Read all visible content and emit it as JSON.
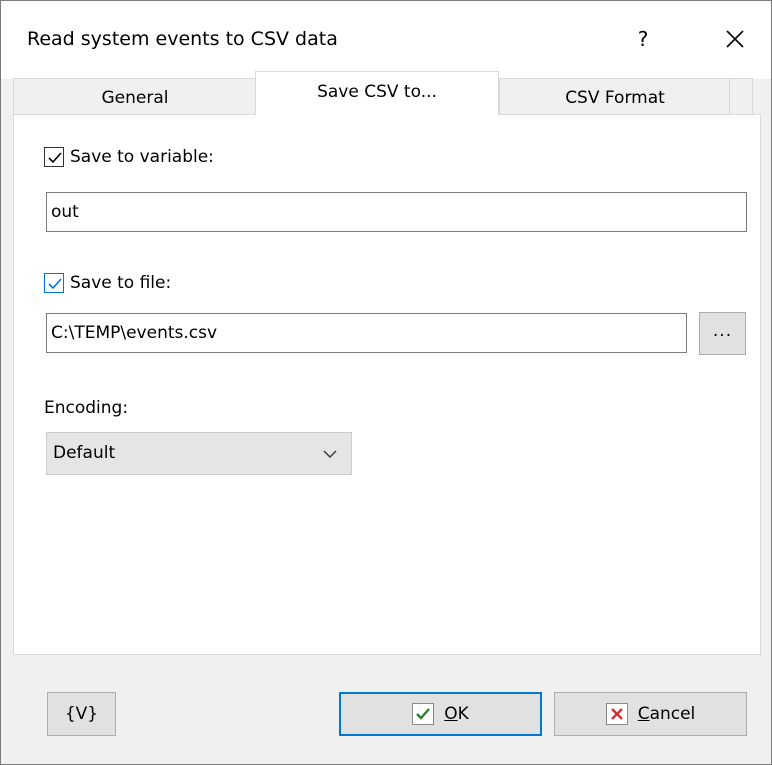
{
  "window": {
    "title": "Read system events to CSV data",
    "help_label": "?"
  },
  "tabs": [
    {
      "label": "General",
      "active": false
    },
    {
      "label": "Save CSV to...",
      "active": true
    },
    {
      "label": "CSV Format",
      "active": false
    }
  ],
  "save_to_variable": {
    "label": "Save to variable:",
    "checked": true,
    "value": "out"
  },
  "save_to_file": {
    "label": "Save to file:",
    "checked": true,
    "value": "C:\\TEMP\\events.csv",
    "browse_label": "..."
  },
  "encoding": {
    "label": "Encoding:",
    "selected": "Default"
  },
  "footer": {
    "variables_label": "{V}",
    "ok_first": "O",
    "ok_rest": "K",
    "cancel_first": "C",
    "cancel_rest": "ancel"
  },
  "colors": {
    "accent": "#0078d7",
    "ok_check": "#2e7d32",
    "cancel_x": "#d32f2f"
  },
  "icons": [
    "close-icon",
    "checkmark-icon",
    "chevron-down-icon",
    "ok-check-icon",
    "cancel-x-icon"
  ]
}
